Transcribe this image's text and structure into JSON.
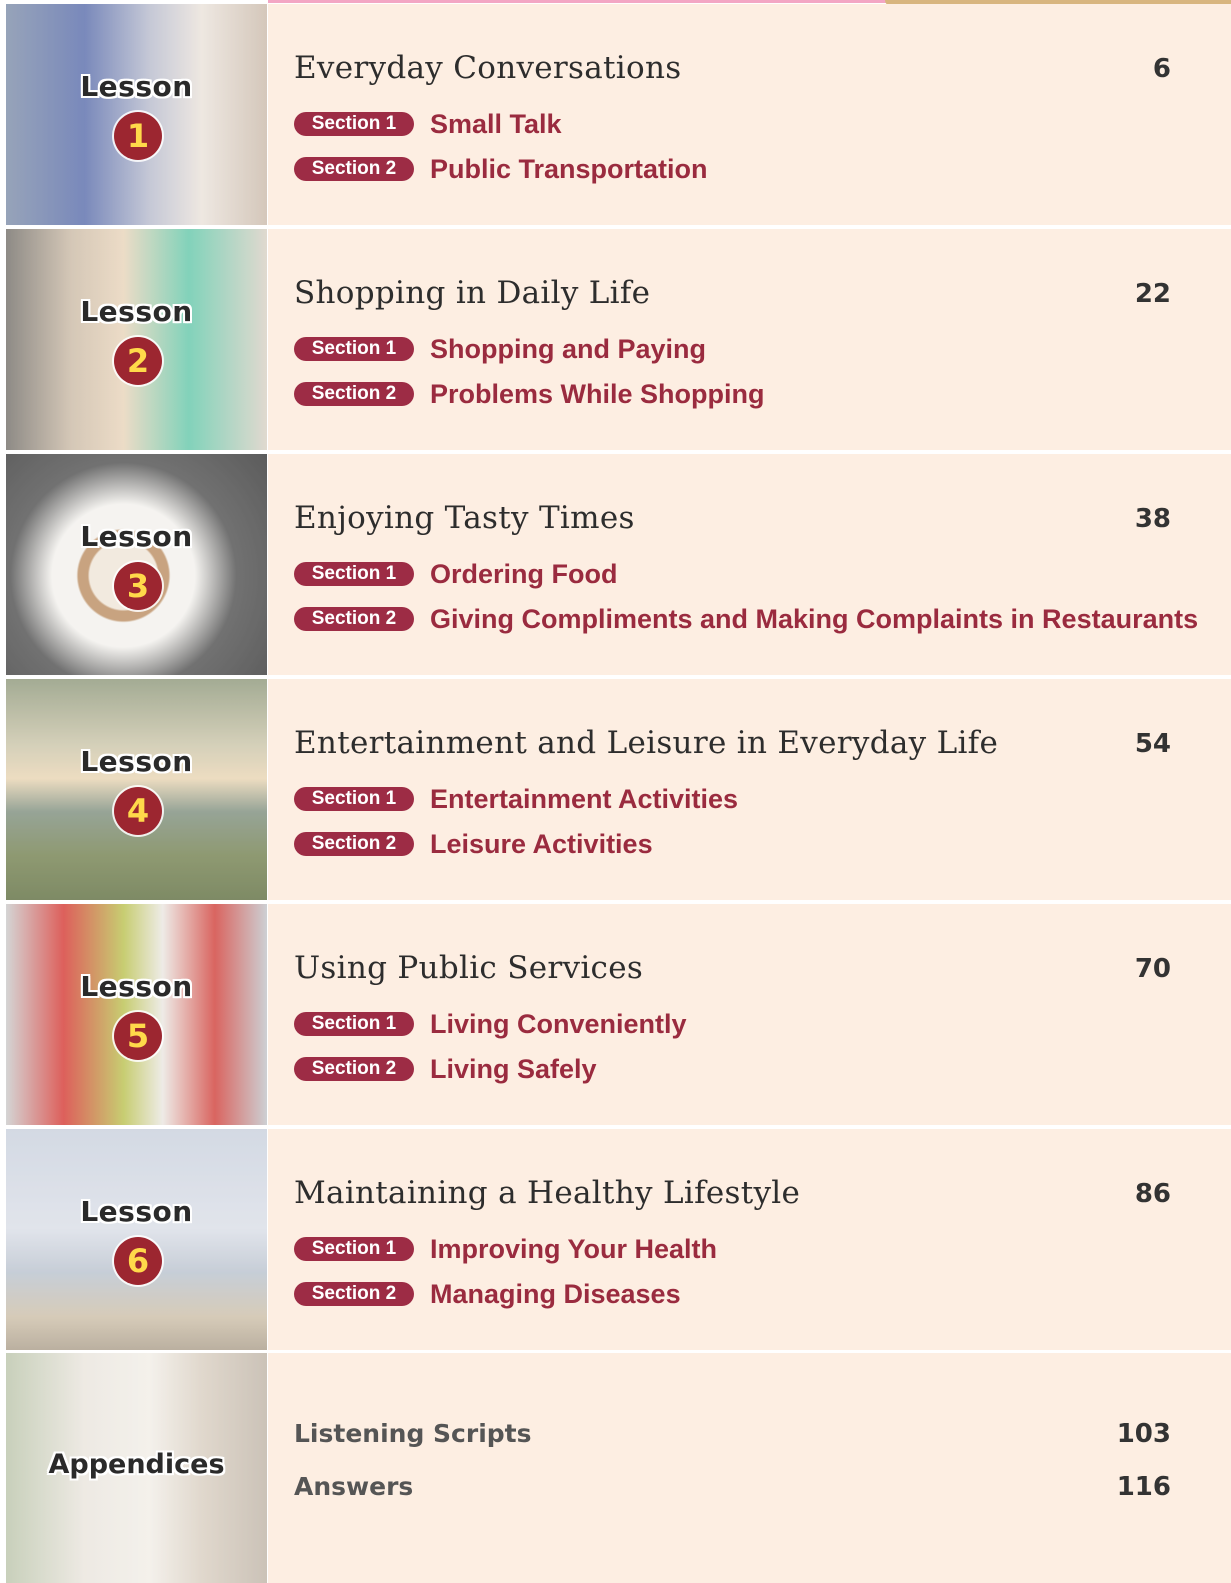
{
  "colors": {
    "background": "#fdeee2",
    "accent": "#9a2b3f",
    "badge": "#9d2c45",
    "number_circle": "#9c2630",
    "number_text": "#ffd94a"
  },
  "lesson_label": "Lesson",
  "lessons": [
    {
      "number": "1",
      "title": "Everyday Conversations",
      "page": "6",
      "sections": [
        {
          "badge": "Section 1",
          "title": "Small Talk"
        },
        {
          "badge": "Section 2",
          "title": "Public Transportation"
        }
      ]
    },
    {
      "number": "2",
      "title": "Shopping in Daily Life",
      "page": "22",
      "sections": [
        {
          "badge": "Section 1",
          "title": "Shopping and Paying"
        },
        {
          "badge": "Section 2",
          "title": "Problems While Shopping"
        }
      ]
    },
    {
      "number": "3",
      "title": "Enjoying Tasty Times",
      "page": "38",
      "sections": [
        {
          "badge": "Section 1",
          "title": "Ordering Food"
        },
        {
          "badge": "Section 2",
          "title": "Giving Compliments and Making Complaints in Restaurants"
        }
      ]
    },
    {
      "number": "4",
      "title": "Entertainment and Leisure in Everyday Life",
      "page": "54",
      "sections": [
        {
          "badge": "Section 1",
          "title": "Entertainment Activities"
        },
        {
          "badge": "Section 2",
          "title": "Leisure Activities"
        }
      ]
    },
    {
      "number": "5",
      "title": "Using Public Services",
      "page": "70",
      "sections": [
        {
          "badge": "Section 1",
          "title": "Living Conveniently"
        },
        {
          "badge": "Section 2",
          "title": "Living Safely"
        }
      ]
    },
    {
      "number": "6",
      "title": "Maintaining a Healthy Lifestyle",
      "page": "86",
      "sections": [
        {
          "badge": "Section 1",
          "title": "Improving Your Health"
        },
        {
          "badge": "Section 2",
          "title": "Managing Diseases"
        }
      ]
    }
  ],
  "appendices": {
    "label": "Appendices",
    "items": [
      {
        "title": "Listening Scripts",
        "page": "103"
      },
      {
        "title": "Answers",
        "page": "116"
      }
    ]
  }
}
